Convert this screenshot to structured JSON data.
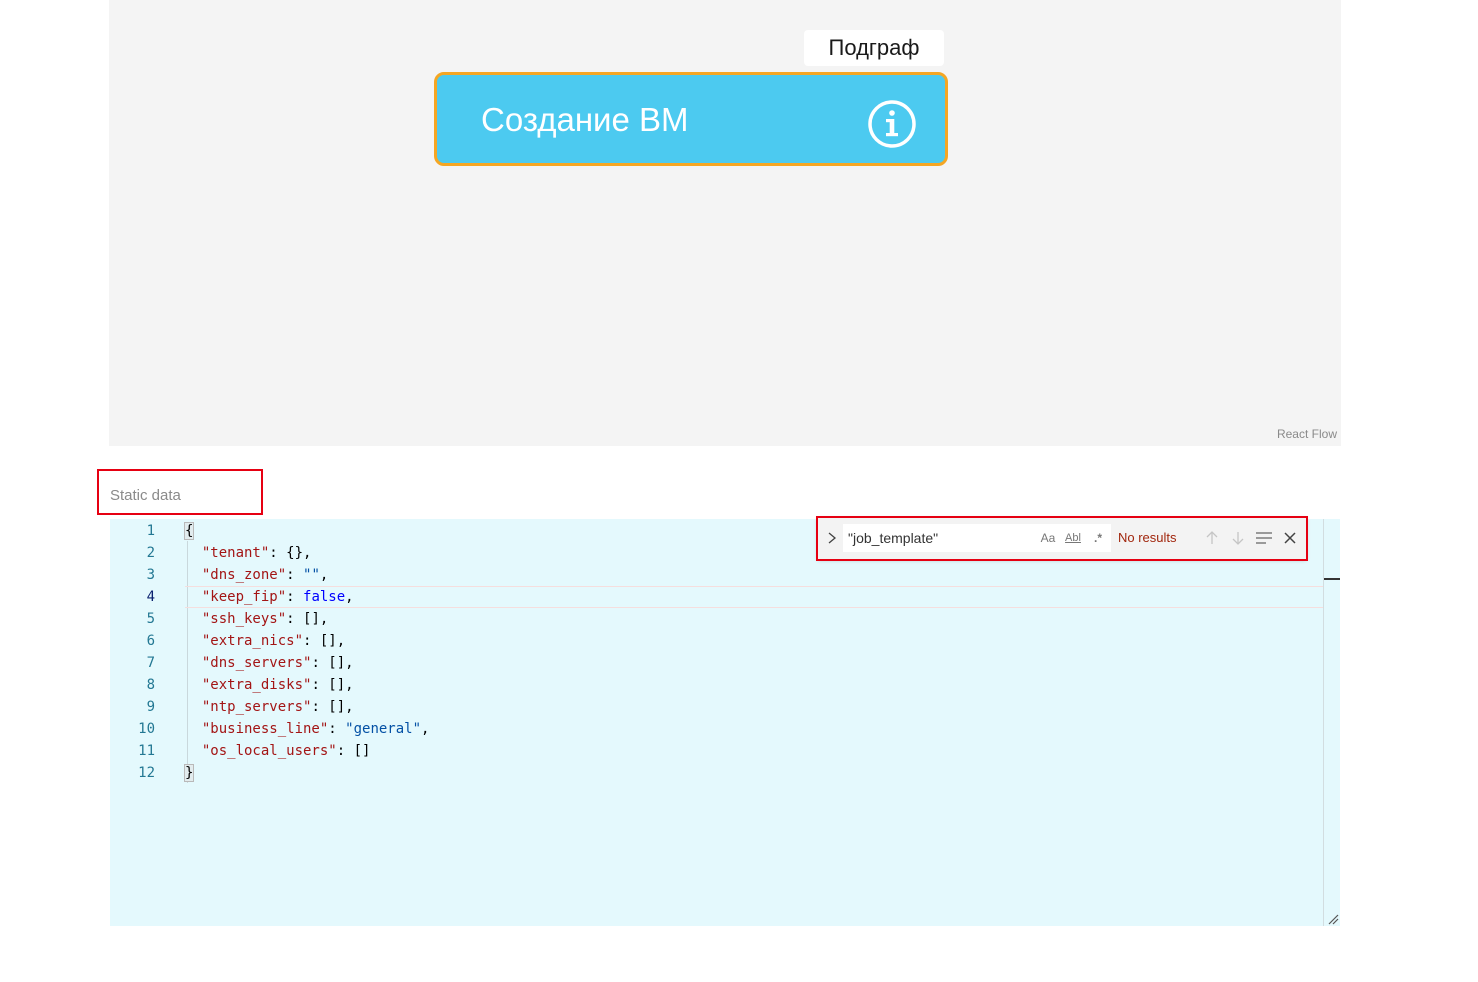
{
  "flow": {
    "subgraph_label": "Подграф",
    "node_title": "Создание ВМ",
    "attribution": "React Flow",
    "colors": {
      "canvas_bg": "#f4f4f4",
      "node_fill": "#4ccaf0",
      "node_border": "#f5a623"
    },
    "info_icon": "info-circle-icon"
  },
  "static_data": {
    "label": "Static data",
    "highlight_color": "#e60012"
  },
  "editor": {
    "background": "#e4f9fd",
    "active_line": 4,
    "lines": [
      {
        "n": "1",
        "key": "",
        "sep": "",
        "val": "{",
        "val_type": "punc",
        "tail": ""
      },
      {
        "n": "2",
        "key": "\"tenant\"",
        "sep": ": ",
        "val": "{}",
        "val_type": "punc",
        "tail": ","
      },
      {
        "n": "3",
        "key": "\"dns_zone\"",
        "sep": ": ",
        "val": "\"\"",
        "val_type": "str",
        "tail": ","
      },
      {
        "n": "4",
        "key": "\"keep_fip\"",
        "sep": ": ",
        "val": "false",
        "val_type": "bool",
        "tail": ","
      },
      {
        "n": "5",
        "key": "\"ssh_keys\"",
        "sep": ": ",
        "val": "[]",
        "val_type": "punc",
        "tail": ","
      },
      {
        "n": "6",
        "key": "\"extra_nics\"",
        "sep": ": ",
        "val": "[]",
        "val_type": "punc",
        "tail": ","
      },
      {
        "n": "7",
        "key": "\"dns_servers\"",
        "sep": ": ",
        "val": "[]",
        "val_type": "punc",
        "tail": ","
      },
      {
        "n": "8",
        "key": "\"extra_disks\"",
        "sep": ": ",
        "val": "[]",
        "val_type": "punc",
        "tail": ","
      },
      {
        "n": "9",
        "key": "\"ntp_servers\"",
        "sep": ": ",
        "val": "[]",
        "val_type": "punc",
        "tail": ","
      },
      {
        "n": "10",
        "key": "\"business_line\"",
        "sep": ": ",
        "val": "\"general\"",
        "val_type": "str",
        "tail": ","
      },
      {
        "n": "11",
        "key": "\"os_local_users\"",
        "sep": ": ",
        "val": "[]",
        "val_type": "punc",
        "tail": ""
      },
      {
        "n": "12",
        "key": "",
        "sep": "",
        "val": "}",
        "val_type": "punc",
        "tail": ""
      }
    ]
  },
  "find_widget": {
    "query": "\"job_template\"",
    "status": "No results",
    "match_case_label": "Aa",
    "whole_word_label": "Abl",
    "regex_label": ".*",
    "icons": {
      "toggle_replace": "chevron-right-icon",
      "prev": "arrow-up-icon",
      "next": "arrow-down-icon",
      "in_selection": "find-in-selection-icon",
      "close": "close-icon"
    }
  }
}
